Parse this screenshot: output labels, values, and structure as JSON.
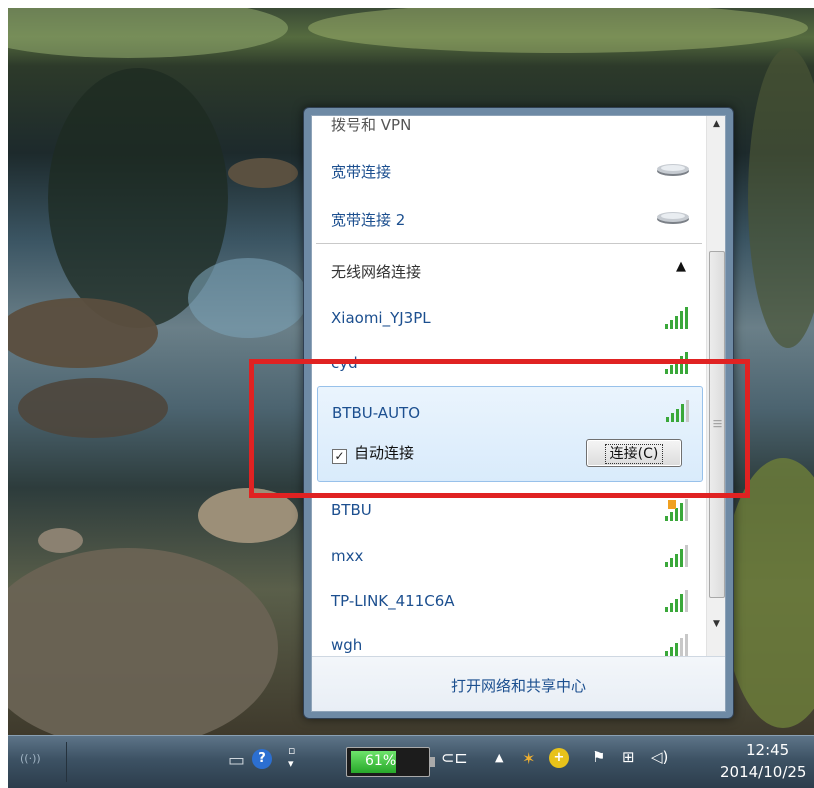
{
  "flyout": {
    "top_partial_label": "拨号和 VPN",
    "dialup_items": [
      {
        "label": "宽带连接",
        "icon": "dialup-modem-icon"
      },
      {
        "label": "宽带连接 2",
        "icon": "dialup-modem-icon"
      }
    ],
    "wireless_header": "无线网络连接",
    "networks": [
      {
        "label": "Xiaomi_YJ3PL",
        "signal": 5,
        "secured": false
      },
      {
        "label": "cyd",
        "signal": 5,
        "secured": false
      },
      {
        "label": "BTBU-AUTO",
        "signal": 4,
        "secured": false
      },
      {
        "label": "BTBU",
        "signal": 4,
        "secured": true
      },
      {
        "label": "mxx",
        "signal": 4,
        "secured": false
      },
      {
        "label": "TP-LINK_411C6A",
        "signal": 4,
        "secured": false
      },
      {
        "label": "wgh",
        "signal": 3,
        "secured": false
      }
    ],
    "selected": {
      "label": "BTBU-AUTO",
      "auto_connect_label": "自动连接",
      "auto_connect_checked": true,
      "connect_button": "连接(C)"
    },
    "footer_link": "打开网络和共享中心"
  },
  "taskbar": {
    "battery_percent": "61%",
    "battery_level": 0.61,
    "clock_time": "12:45",
    "clock_date": "2014/10/25"
  },
  "colors": {
    "link_blue": "#1c4f8f",
    "highlight_red": "#e02222",
    "signal_green": "#3aa83a"
  }
}
